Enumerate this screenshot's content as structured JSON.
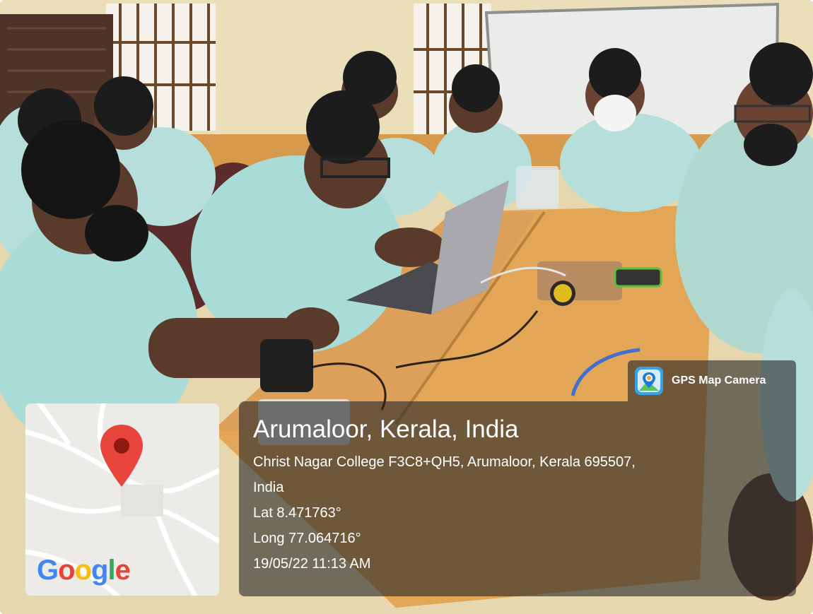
{
  "overlay": {
    "brand_label": "GPS Map Camera",
    "place_title": "Arumaloor, Kerala, India",
    "address_line1": "Christ Nagar College F3C8+QH5, Arumaloor, Kerala 695507,",
    "address_line2": "India",
    "latitude": "Lat 8.471763°",
    "longitude": "Long 77.064716°",
    "datetime": "19/05/22 11:13 AM"
  },
  "map": {
    "logo_letters": [
      "G",
      "o",
      "o",
      "g",
      "l",
      "e"
    ],
    "pin_color": "#e8453c"
  },
  "colors": {
    "overlay_bg": "rgba(40,40,40,0.62)",
    "table_wood": "#e2a656",
    "shirt": "#a9dcd6"
  }
}
